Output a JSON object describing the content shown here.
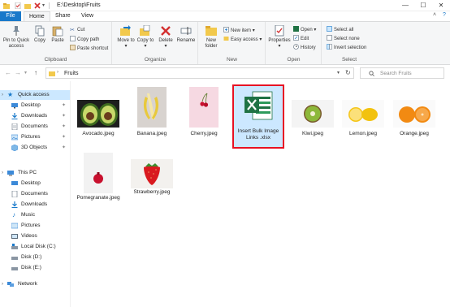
{
  "window": {
    "path_title": "E:\\Desktop\\Fruits",
    "quick_icons": [
      "explorer-folder-icon",
      "properties-check-icon",
      "new-folder-icon",
      "delete-x-icon",
      "customize-arrow-icon"
    ]
  },
  "tabs": [
    {
      "label": "File"
    },
    {
      "label": "Home"
    },
    {
      "label": "Share"
    },
    {
      "label": "View"
    }
  ],
  "ribbon": {
    "clipboard": {
      "label": "Clipboard",
      "pin": "Pin to Quick access",
      "copy": "Copy",
      "paste": "Paste",
      "cut": "Cut",
      "copy_path": "Copy path",
      "paste_shortcut": "Paste shortcut"
    },
    "organize": {
      "label": "Organize",
      "move_to": "Move to",
      "copy_to": "Copy to",
      "delete": "Delete",
      "rename": "Rename"
    },
    "new": {
      "label": "New",
      "new_folder": "New folder",
      "new_item": "New item",
      "easy_access": "Easy access"
    },
    "open": {
      "label": "Open",
      "properties": "Properties",
      "open": "Open",
      "edit": "Edit",
      "history": "History"
    },
    "select": {
      "label": "Select",
      "select_all": "Select all",
      "select_none": "Select none",
      "invert_selection": "Invert selection"
    }
  },
  "address": {
    "path": "Fruits",
    "search_placeholder": "Search Fruits"
  },
  "sidebar": {
    "quick_access": "Quick access",
    "quick_items": [
      "Desktop",
      "Downloads",
      "Documents",
      "Pictures",
      "3D Objects"
    ],
    "this_pc": "This PC",
    "pc_items": [
      "Desktop",
      "Documents",
      "Downloads",
      "Music",
      "Pictures",
      "Videos",
      "Local Disk (C:)",
      "Disk (D:)",
      "Disk (E:)"
    ],
    "network": "Network"
  },
  "files": [
    {
      "name": "Avocado.jpeg"
    },
    {
      "name": "Banana.jpeg"
    },
    {
      "name": "Cherry.jpeg"
    },
    {
      "name": "Insert Bulk Image Links .xlsx"
    },
    {
      "name": "Kiwi.jpeg"
    },
    {
      "name": "Lemon.jpeg"
    },
    {
      "name": "Orange.jpeg"
    },
    {
      "name": "Pomegranate.jpeg"
    },
    {
      "name": "Strawberry.jpeg"
    }
  ],
  "colors": {
    "accent": "#1979ca",
    "selection": "#cce8ff",
    "highlight_border": "#e81123",
    "excel_green": "#1f7244"
  }
}
